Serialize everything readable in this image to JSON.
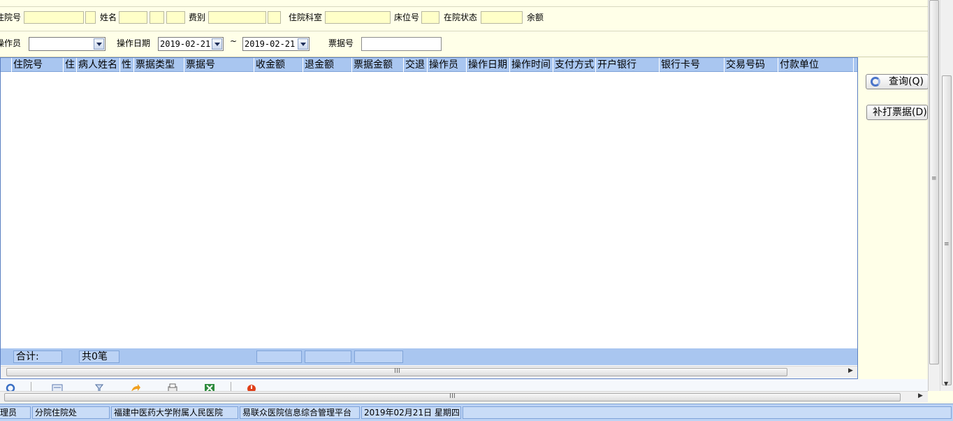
{
  "filters": {
    "row1": {
      "admission_no_label": "住院号",
      "name_label": "姓名",
      "fee_type_label": "费别",
      "ward_label": "住院科室",
      "bed_label": "床位号",
      "status_label": "在院状态",
      "balance_label": "余额"
    },
    "row2": {
      "operator_label": "操作员",
      "operator_value": "",
      "date_label": "操作日期",
      "date_from": "2019-02-21",
      "tilde": "~",
      "date_to": "2019-02-21",
      "receipt_label": "票据号",
      "receipt_value": ""
    }
  },
  "grid": {
    "columns": [
      "住院号",
      "住",
      "病人姓名",
      "性",
      "票据类型",
      "票据号",
      "收金额",
      "退金额",
      "票据金额",
      "交退",
      "操作员",
      "操作日期",
      "操作时间",
      "支付方式",
      "开户银行",
      "银行卡号",
      "交易号码",
      "付款单位"
    ],
    "rows": [],
    "footer": {
      "total_label": "合计:",
      "count_label": "共0笔"
    }
  },
  "buttons": {
    "query": "查询(Q)",
    "reprint": "补打票据(D)"
  },
  "toolbar": {
    "icons": [
      "refresh-icon",
      "list-icon",
      "filter-icon",
      "forward-icon",
      "print-icon",
      "excel-icon",
      "power-icon"
    ]
  },
  "statusbar": {
    "role": "理员",
    "department": "分院住院处",
    "hospital": "福建中医药大学附属人民医院",
    "system": "易联众医院信息综合管理平台",
    "date": "2019年02月21日 星期四"
  },
  "colors": {
    "accent": "#a9c6f0",
    "field_bg": "#ffffc8",
    "panel_bg": "#ffffe8"
  }
}
